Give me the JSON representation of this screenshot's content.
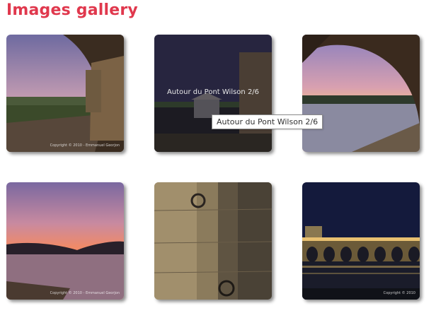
{
  "page": {
    "title": "Images gallery"
  },
  "accent_color": "#e0384d",
  "gallery": {
    "items": [
      {
        "icon": "photo-icon",
        "copyright": "Copyright © 2010 - Emmanuel Georjon"
      },
      {
        "icon": "photo-icon",
        "caption": "Autour du Pont Wilson 2/6"
      },
      {
        "icon": "photo-icon"
      },
      {
        "icon": "photo-icon",
        "copyright": "Copyright © 2010 - Emmanuel Georjon"
      },
      {
        "icon": "photo-icon"
      },
      {
        "icon": "photo-icon",
        "copyright": "Copyright © 2010"
      }
    ]
  },
  "tooltip": {
    "text": "Autour du Pont Wilson 2/6"
  }
}
